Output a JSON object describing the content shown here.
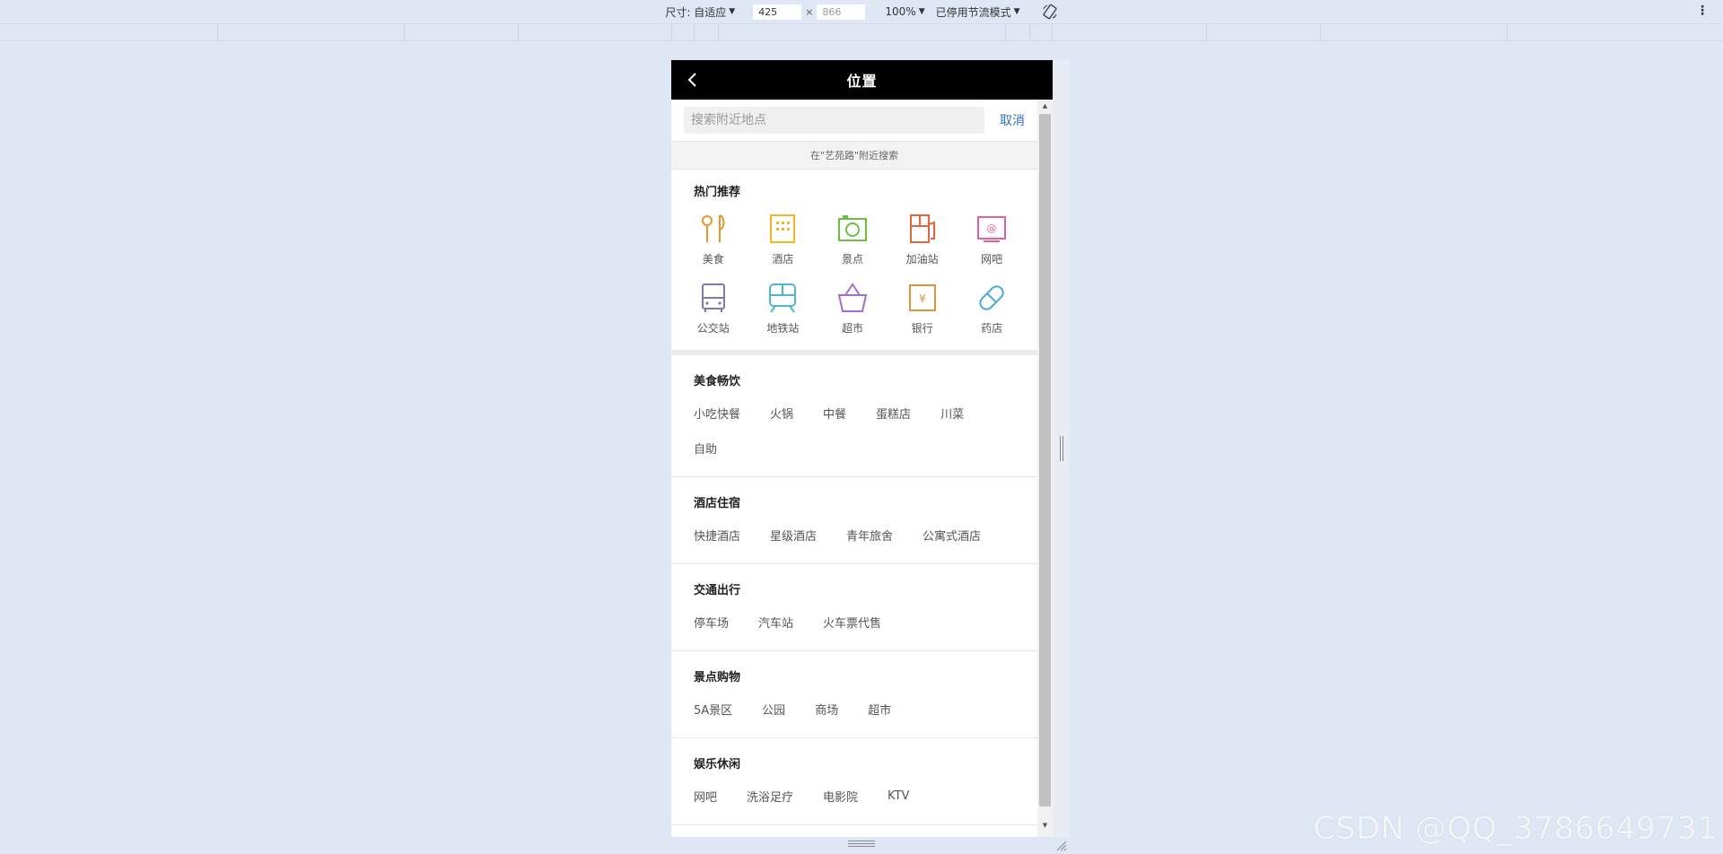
{
  "devtools": {
    "dimensions_label": "尺寸: 自适应",
    "width_value": "425",
    "height_value": "866",
    "times": "×",
    "zoom_label": "100%",
    "throttle_label": "已停用节流模式"
  },
  "app": {
    "title": "位置",
    "search": {
      "placeholder": "搜索附近地点",
      "cancel_label": "取消"
    },
    "hint": "在\"艺苑路\"附近搜索",
    "hot": {
      "title": "热门推荐",
      "items": [
        {
          "label": "美食",
          "icon": "food-icon",
          "color": "#e8962b"
        },
        {
          "label": "酒店",
          "icon": "hotel-icon",
          "color": "#f2b824"
        },
        {
          "label": "景点",
          "icon": "camera-icon",
          "color": "#6cbf40"
        },
        {
          "label": "加油站",
          "icon": "gas-station-icon",
          "color": "#e8643c"
        },
        {
          "label": "网吧",
          "icon": "internet-cafe-icon",
          "color": "#e0609c"
        },
        {
          "label": "公交站",
          "icon": "bus-icon",
          "color": "#7b7bb0"
        },
        {
          "label": "地铁站",
          "icon": "subway-icon",
          "color": "#4fb6d0"
        },
        {
          "label": "超市",
          "icon": "basket-icon",
          "color": "#a36ec8"
        },
        {
          "label": "银行",
          "icon": "bank-icon",
          "color": "#e0923c"
        },
        {
          "label": "药店",
          "icon": "pill-icon",
          "color": "#4aa8dc"
        }
      ]
    },
    "categories": [
      {
        "title": "美食畅饮",
        "items": [
          "小吃快餐",
          "火锅",
          "中餐",
          "蛋糕店",
          "川菜",
          "自助"
        ]
      },
      {
        "title": "酒店住宿",
        "items": [
          "快捷酒店",
          "星级酒店",
          "青年旅舍",
          "公寓式酒店"
        ]
      },
      {
        "title": "交通出行",
        "items": [
          "停车场",
          "汽车站",
          "火车票代售"
        ]
      },
      {
        "title": "景点购物",
        "items": [
          "5A景区",
          "公园",
          "商场",
          "超市"
        ]
      },
      {
        "title": "娱乐休闲",
        "items": [
          "网吧",
          "洗浴足疗",
          "电影院",
          "KTV"
        ]
      }
    ]
  },
  "watermark": "CSDN @QQ_3786649731"
}
